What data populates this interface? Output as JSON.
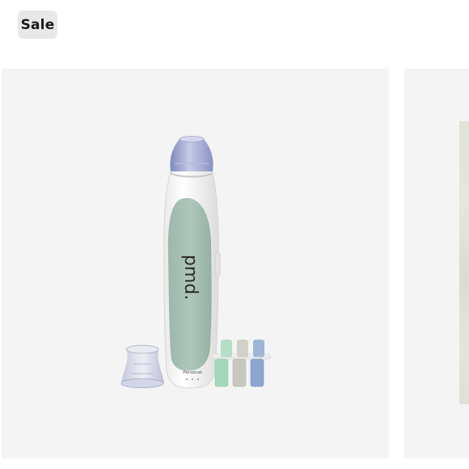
{
  "badge": {
    "label": "Sale"
  },
  "product": {
    "brand_logo": "pmd.",
    "device_label": "Personal",
    "image_name": "pmd-microdermabrasion-device",
    "colors": {
      "card_bg": "#f4f4f4",
      "grip": "#a9c4b6",
      "body": "#fbfbfb",
      "cap": "#9aa3cf",
      "disc_green": "#a8d9bd",
      "disc_grey": "#c9c8c2",
      "disc_blue": "#8fa8cf"
    }
  }
}
